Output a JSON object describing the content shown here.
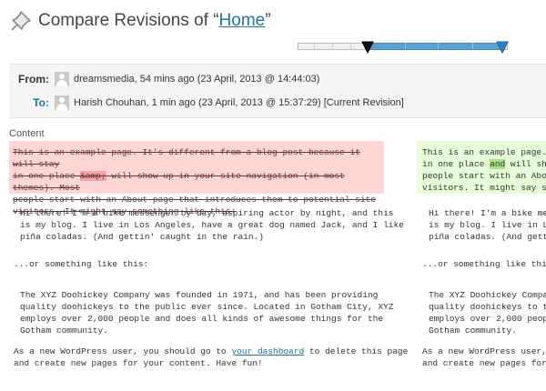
{
  "header": {
    "title_prefix": "Compare Revisions of “",
    "title_link": "Home",
    "title_suffix": "”"
  },
  "slider": {
    "from_position_fraction": 0.33,
    "to_position_fraction": 0.98
  },
  "revisions": {
    "from_label": "From:",
    "from_text": "dreamsmedia, 54 mins ago (23 April, 2013 @ 14:44:03)",
    "to_label": "To:",
    "to_text": "Harish Chouhan, 1 min ago (23 April, 2013 @ 15:37:29) [Current Revision]"
  },
  "content_label": "Content",
  "left": {
    "deleted_line1": "This is an example page. It's different from a blog post because it will stay",
    "deleted_line2_pre": "in one place ",
    "deleted_line2_word": "&amp;",
    "deleted_line2_post": " will show up in your site navigation (in most themes). Most",
    "deleted_line3": "people start with an About page that introduces them to potential site",
    "deleted_line4": "visitors. It might say something like this:",
    "p1_line1": "Hi there! I'm a bike messenger by day, aspiring actor by night, and this",
    "p1_line2": "is my blog. I live in Los Angeles, have a great dog named Jack, and I like",
    "p1_line3": "piña coladas. (And gettin' caught in the rain.)",
    "p2": "...or something like this:",
    "p3_line1": "The XYZ Doohickey Company was founded in 1971, and has been providing",
    "p3_line2": "quality doohickeys to the public ever since. Located in Gotham City, XYZ",
    "p3_line3": "employs over 2,000 people and does all kinds of awesome things for the",
    "p3_line4": "Gotham community.",
    "p4_line1_pre": "As a new WordPress user, you should go to ",
    "p4_link": "your dashboard",
    "p4_line1_post": " to delete this page",
    "p4_line2": "and create new pages for your content. Have fun!"
  },
  "right": {
    "added_line1": "This is an example page. It",
    "added_line2_pre": "in one place ",
    "added_line2_word": "and",
    "added_line2_post": " will show",
    "added_line3": "people start with an About",
    "added_line4": "visitors. It might say some",
    "p1_line1": "Hi there! I'm a bike messe",
    "p1_line2": "is my blog. I live in Los",
    "p1_line3": "piña coladas. (And gettin'",
    "p2": "...or something like this:",
    "p3_line1": "The XYZ Doohickey Company",
    "p3_line2": "quality doohickeys to the",
    "p3_line3": "employs over 2,000 people",
    "p3_line4": "Gotham community.",
    "p4_line1": "As a new WordPress user, y",
    "p4_line2": "and create new pages for y"
  }
}
